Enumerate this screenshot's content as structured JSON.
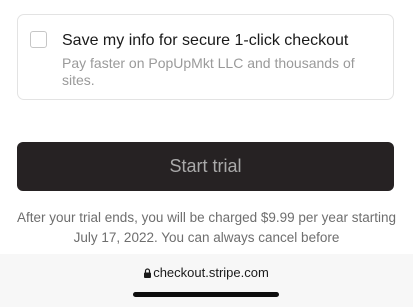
{
  "save_info": {
    "checked": false,
    "title": "Save my info for secure 1-click checkout",
    "description": "Pay faster on PopUpMkt LLC and thousands of sites."
  },
  "start_button": {
    "label": "Start trial"
  },
  "terms": {
    "text": "After your trial ends, you will be charged $9.99 per year starting July 17, 2022. You can always cancel before"
  },
  "browser": {
    "lock_icon": "lock-icon",
    "url": "checkout.stripe.com"
  }
}
